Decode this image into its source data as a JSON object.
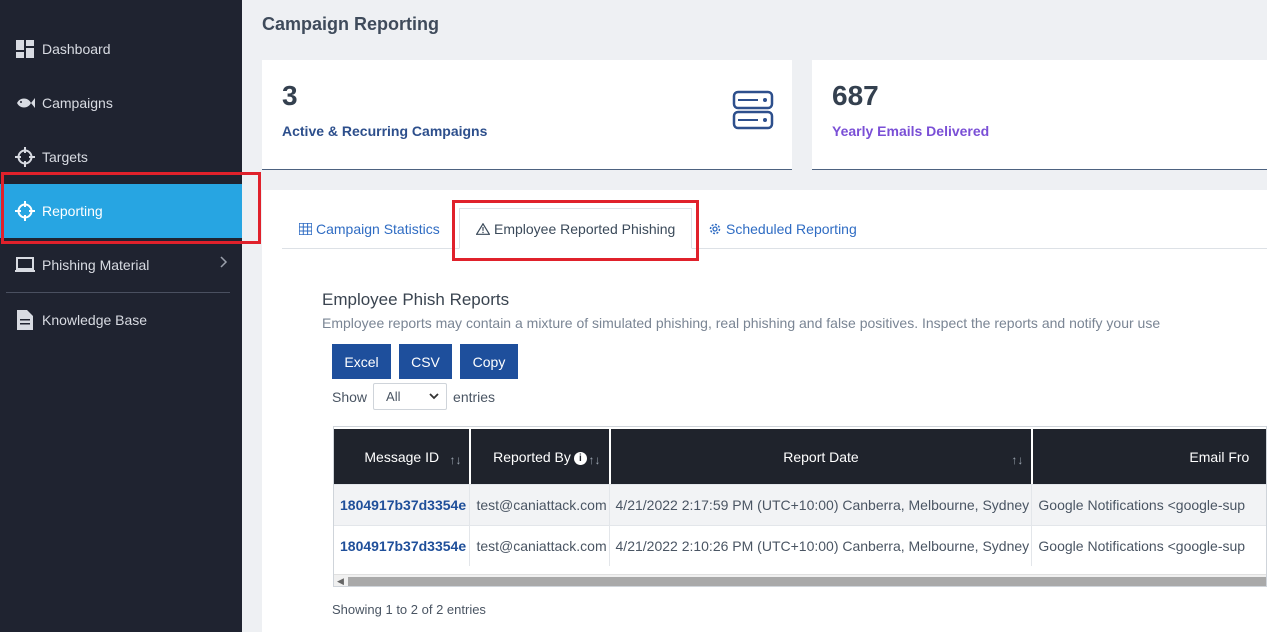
{
  "sidebar": {
    "items": [
      {
        "label": "Dashboard"
      },
      {
        "label": "Campaigns"
      },
      {
        "label": "Targets"
      },
      {
        "label": "Reporting"
      },
      {
        "label": "Phishing Material"
      },
      {
        "label": "Knowledge Base"
      }
    ]
  },
  "header": {
    "title": "Campaign Reporting"
  },
  "cards": [
    {
      "value": "3",
      "label": "Active & Recurring Campaigns",
      "color": "#2d4f8c"
    },
    {
      "value": "687",
      "label": "Yearly Emails Delivered",
      "color": "#7a4fd6"
    }
  ],
  "tabs": [
    {
      "label": "Campaign Statistics"
    },
    {
      "label": "Employee Reported Phishing"
    },
    {
      "label": "Scheduled Reporting"
    }
  ],
  "section": {
    "title": "Employee Phish Reports",
    "description": "Employee reports may contain a mixture of simulated phishing, real phishing and false positives. Inspect the reports and notify your use"
  },
  "export_buttons": {
    "excel": "Excel",
    "csv": "CSV",
    "copy": "Copy"
  },
  "show_entries": {
    "show_label": "Show",
    "selected": "All",
    "entries_label": "entries"
  },
  "table": {
    "headers": [
      "Message ID",
      "Reported By",
      "Report Date",
      "Email Fro"
    ],
    "rows": [
      [
        "1804917b37d3354e",
        "test@caniattack.com",
        "4/21/2022 2:17:59 PM (UTC+10:00) Canberra, Melbourne, Sydney",
        "Google Notifications <google-sup"
      ],
      [
        "1804917b37d3354e",
        "test@caniattack.com",
        "4/21/2022 2:10:26 PM (UTC+10:00) Canberra, Melbourne, Sydney",
        "Google Notifications <google-sup"
      ]
    ]
  },
  "footer": {
    "info": "Showing 1 to 2 of 2 entries"
  },
  "colors": {
    "sidebar_bg": "#1f2330",
    "active_nav": "#27a5e2",
    "button": "#1e4f9c",
    "highlight": "#e0212b"
  }
}
